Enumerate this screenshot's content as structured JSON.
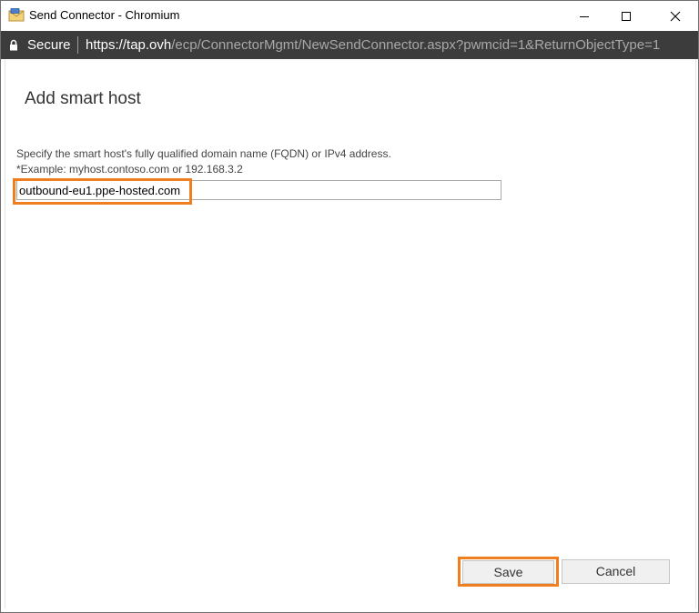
{
  "window": {
    "title": "Send Connector - Chromium"
  },
  "addressbar": {
    "secure_label": "Secure",
    "url_host": "https://tap.ovh",
    "url_path": "/ecp/ConnectorMgmt/NewSendConnector.aspx?pwmcid=1&ReturnObjectType=1"
  },
  "page": {
    "title": "Add smart host",
    "description": "Specify the smart host's fully qualified domain name (FQDN) or IPv4 address.",
    "example": "*Example: myhost.contoso.com or 192.168.3.2"
  },
  "form": {
    "fqdn_value": "outbound-eu1.ppe-hosted.com"
  },
  "actions": {
    "save_label": "Save",
    "cancel_label": "Cancel"
  },
  "colors": {
    "highlight": "#f07d1e",
    "addressbar_bg": "#3c3c3c"
  },
  "icons": {
    "app": "mail-envelope-icon",
    "lock": "lock-icon",
    "minimize": "minimize-icon",
    "maximize": "maximize-icon",
    "close": "close-icon"
  }
}
